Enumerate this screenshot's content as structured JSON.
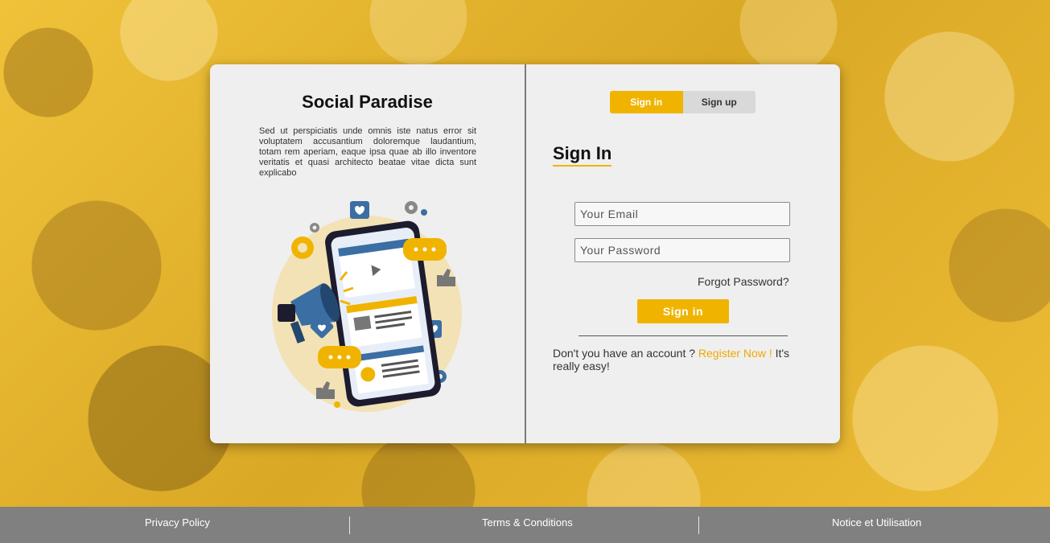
{
  "left": {
    "title": "Social Paradise",
    "description": "Sed ut perspiciatis unde omnis iste natus error sit voluptatem accusantium doloremque laudantium, totam rem aperiam, eaque ipsa quae ab illo inventore veritatis et quasi architecto beatae vitae dicta sunt explicabo"
  },
  "tabs": {
    "signin": "Sign in",
    "signup": "Sign up",
    "active": "signin"
  },
  "form": {
    "heading": "Sign In",
    "email_placeholder": "Your Email",
    "password_placeholder": "Your Password",
    "forgot": "Forgot Password?",
    "submit": "Sign in"
  },
  "register": {
    "prefix": "Don't you have an account ? ",
    "link": "Register Now !",
    "suffix": " It's really easy!"
  },
  "footer": {
    "privacy": "Privacy Policy",
    "terms": "Terms & Conditions",
    "notice": "Notice et Utilisation"
  },
  "colors": {
    "accent": "#f0b400",
    "footer": "#808080",
    "card": "#efefef"
  }
}
